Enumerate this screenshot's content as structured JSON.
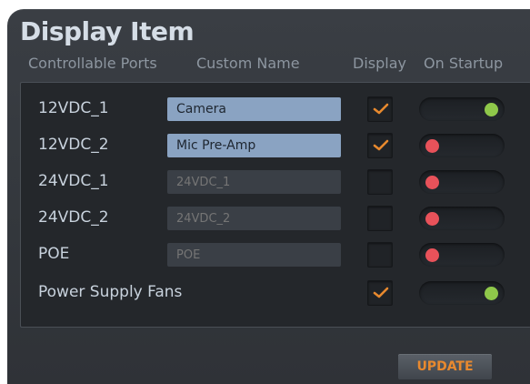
{
  "title": "Display Item",
  "columns": {
    "ports": "Controllable Ports",
    "custom_name": "Custom Name",
    "display": "Display",
    "on_startup": "On Startup"
  },
  "rows": [
    {
      "port": "12VDC_1",
      "name": "Camera",
      "name_editable": true,
      "display": true,
      "startup": "on"
    },
    {
      "port": "12VDC_2",
      "name": "Mic Pre-Amp",
      "name_editable": true,
      "display": true,
      "startup": "off"
    },
    {
      "port": "24VDC_1",
      "name": "24VDC_1",
      "name_editable": false,
      "display": false,
      "startup": "off"
    },
    {
      "port": "24VDC_2",
      "name": "24VDC_2",
      "name_editable": false,
      "display": false,
      "startup": "off"
    },
    {
      "port": "POE",
      "name": "POE",
      "name_editable": false,
      "display": false,
      "startup": "off"
    },
    {
      "port": "Power Supply Fans",
      "name": null,
      "name_editable": false,
      "display": true,
      "startup": "on"
    }
  ],
  "update_label": "UPDATE",
  "colors": {
    "accent": "#e8892e",
    "on": "#8fc84a",
    "off": "#e8525a"
  }
}
